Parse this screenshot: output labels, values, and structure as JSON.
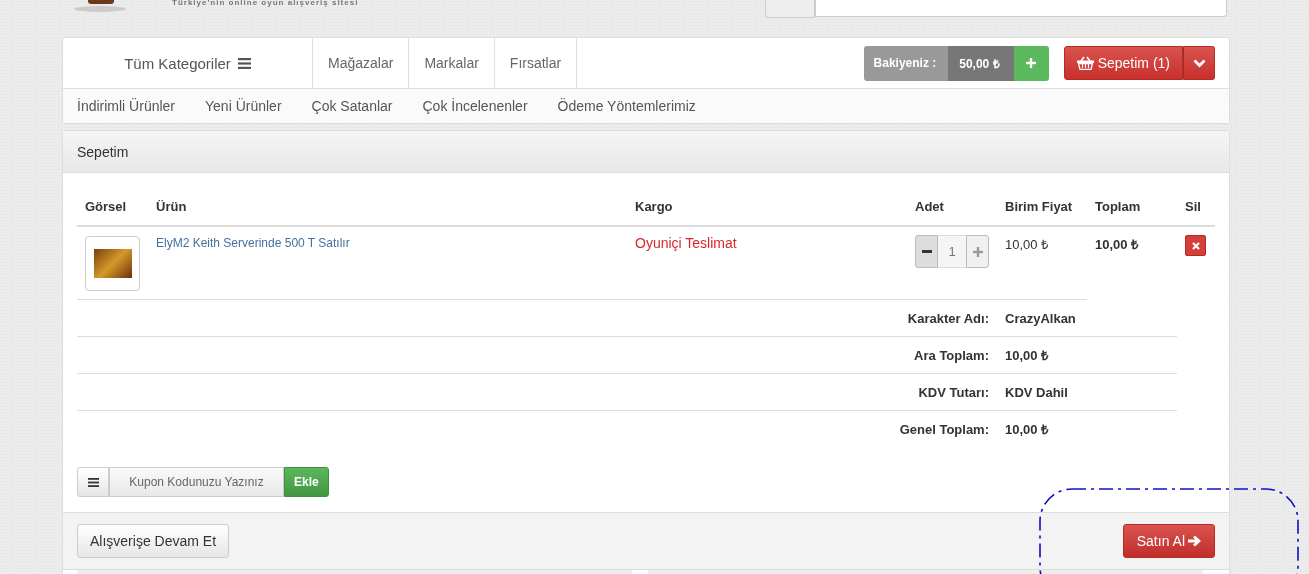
{
  "header": {
    "tagline": "Türkiye'nin online oyun alışveriş sitesi"
  },
  "nav": {
    "category_menu": "Tüm Kategoriler",
    "links": [
      "Mağazalar",
      "Markalar",
      "Fırsatlar"
    ],
    "balance": {
      "label": "Bakiyeniz :",
      "amount": "50,00 ₺"
    },
    "cart_button": "Sepetim (1)",
    "sub_links": [
      "İndirimli Ürünler",
      "Yeni Ürünler",
      "Çok Satanlar",
      "Çok İncelenenler",
      "Ödeme Yöntemlerimiz"
    ]
  },
  "cart": {
    "title": "Sepetim",
    "columns": [
      "Görsel",
      "Ürün",
      "Kargo",
      "Adet",
      "Birim Fiyat",
      "Toplam",
      "Sil"
    ],
    "items": [
      {
        "product": "ElyM2 Keith Serverinde 500 T Satılır",
        "shipping": "Oyuniçi Teslimat",
        "quantity": "1",
        "unit_price": "10,00 ₺",
        "total": "10,00 ₺"
      }
    ],
    "summary": [
      {
        "label": "Karakter Adı:",
        "value": "CrazyAlkan"
      },
      {
        "label": "Ara Toplam:",
        "value": "10,00 ₺"
      },
      {
        "label": "KDV Tutarı:",
        "value": "KDV Dahil"
      },
      {
        "label": "Genel Toplam:",
        "value": "10,00 ₺"
      }
    ],
    "coupon": {
      "placeholder": "Kupon Kodunuzu Yazınız",
      "button": "Ekle"
    },
    "continue_button": "Alışverişe Devam Et",
    "buy_button": "Satın Al"
  }
}
